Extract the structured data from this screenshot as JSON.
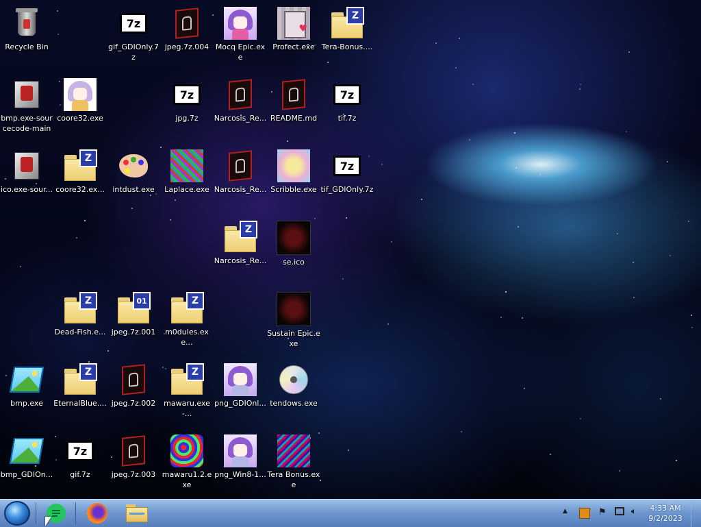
{
  "desktop": {
    "icons": [
      {
        "label": "Recycle Bin",
        "type": "recycle-bin-icon"
      },
      {
        "label": "gif_GDIOnly.7z",
        "type": "archive-7z-icon"
      },
      {
        "label": "jpeg.7z.004",
        "type": "dark-exe-icon"
      },
      {
        "label": "Mocq Epic.exe",
        "type": "anime-girl-icon"
      },
      {
        "label": "Profect.exe",
        "type": "pixel-girl-icon"
      },
      {
        "label": "Tera-Bonus....",
        "type": "zip-folder-icon"
      },
      {
        "label": "bmp.exe-sourcecode-main",
        "type": "bmp-source-icon"
      },
      {
        "label": "coore32.exe",
        "type": "anime-chibi-icon"
      },
      {
        "label": "jpg.7z",
        "type": "archive-7z-icon"
      },
      {
        "label": "Narcosis_Re...",
        "type": "dark-exe-icon"
      },
      {
        "label": "README.md",
        "type": "dark-exe-icon"
      },
      {
        "label": "tif.7z",
        "type": "archive-7z-icon"
      },
      {
        "label": "ico.exe-sour...",
        "type": "bmp-source-icon"
      },
      {
        "label": "coore32.ex...",
        "type": "zip-folder-icon"
      },
      {
        "label": "intdust.exe",
        "type": "palette-icon"
      },
      {
        "label": "Laplace.exe",
        "type": "noise-image-icon"
      },
      {
        "label": "Narcosis_Re...",
        "type": "dark-exe-icon"
      },
      {
        "label": "Scribble.exe",
        "type": "scribble-image-icon"
      },
      {
        "label": "tif_GDIOnly.7z",
        "type": "archive-7z-icon"
      },
      {
        "label": "Narcosis_Re...",
        "type": "zip-folder-icon"
      },
      {
        "label": "se.ico",
        "type": "dark-image-icon"
      },
      {
        "label": "Dead-Fish.e...",
        "type": "zip-folder-icon"
      },
      {
        "label": "jpeg.7z.001",
        "type": "numbered-folder-icon",
        "badge": "01"
      },
      {
        "label": "m0dules.exe...",
        "type": "zip-folder-icon"
      },
      {
        "label": "Sustain Epic.exe",
        "type": "dark-image-icon"
      },
      {
        "label": "bmp.exe",
        "type": "landscape-image-icon"
      },
      {
        "label": "EternalBlue....",
        "type": "zip-folder-icon"
      },
      {
        "label": "jpeg.7z.002",
        "type": "dark-exe-icon"
      },
      {
        "label": "mawaru.exe-...",
        "type": "zip-folder-icon"
      },
      {
        "label": "png_GDIOnl...",
        "type": "anime-girl-icon"
      },
      {
        "label": "tendows.exe",
        "type": "cd-drive-icon"
      },
      {
        "label": "bmp_GDIOn...",
        "type": "landscape-image-icon"
      },
      {
        "label": "gif.7z",
        "type": "archive-7z-icon"
      },
      {
        "label": "jpeg.7z.003",
        "type": "dark-exe-icon"
      },
      {
        "label": "mawaru1.2.exe",
        "type": "noise-image-icon"
      },
      {
        "label": "png_Win8-1...",
        "type": "anime-girl-icon"
      },
      {
        "label": "Tera Bonus.exe",
        "type": "noise-image-icon"
      }
    ]
  },
  "archive_text": "7z",
  "zip_badge": "Z",
  "taskbar": {
    "start": "start-orb-icon",
    "pinned": [
      "notes-app-icon",
      "firefox-icon",
      "file-explorer-icon"
    ],
    "tray": [
      "chevron-up-icon",
      "app-tray-icon",
      "flag-icon",
      "network-icon",
      "volume-icon"
    ],
    "time": "4:33 AM",
    "date": "9/2/2023"
  }
}
